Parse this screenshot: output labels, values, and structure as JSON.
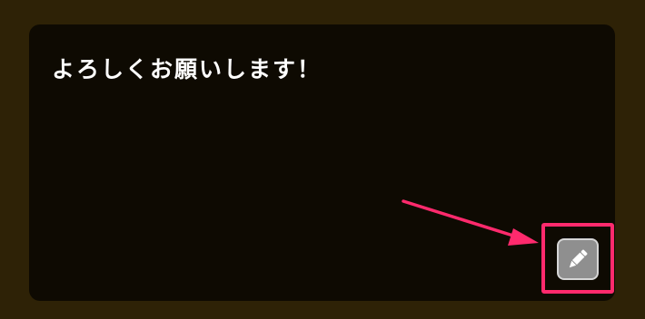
{
  "panel": {
    "message": "よろしくお願いします！",
    "edit_button_icon": "pencil-icon"
  },
  "annotation": {
    "color": "#ff2a6d",
    "type": "arrow-and-box"
  }
}
